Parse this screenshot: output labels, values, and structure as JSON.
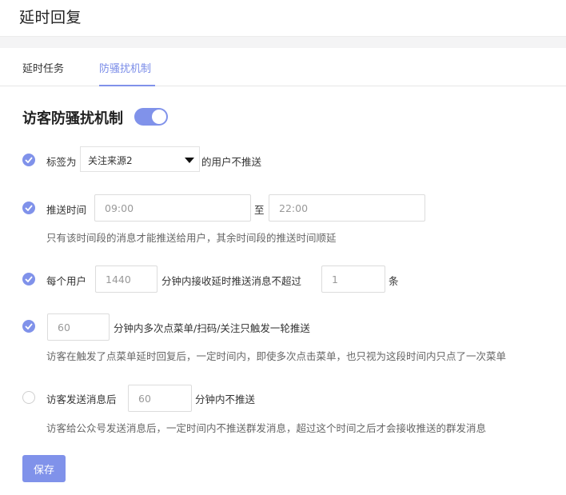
{
  "page": {
    "title": "延时回复"
  },
  "tabs": [
    {
      "label": "延时任务",
      "active": false
    },
    {
      "label": "防骚扰机制",
      "active": true
    }
  ],
  "section": {
    "title": "访客防骚扰机制",
    "enabled": true
  },
  "rules": {
    "tag": {
      "checked": true,
      "prefix": "标签为",
      "selected": "关注来源2",
      "suffix": "的用户不推送"
    },
    "push_time": {
      "checked": true,
      "label": "推送时间",
      "start_placeholder": "09:00",
      "separator": "至",
      "end_placeholder": "22:00",
      "hint": "只有该时间段的消息才能推送给用户，其余时间段的推送时间顺延"
    },
    "per_user": {
      "checked": true,
      "label": "每个用户",
      "minutes_placeholder": "1440",
      "middle": "分钟内接收延时推送消息不超过",
      "count_placeholder": "1",
      "unit": "条"
    },
    "menu_click": {
      "checked": true,
      "minutes_placeholder": "60",
      "text": "分钟内多次点菜单/扫码/关注只触发一轮推送",
      "hint": "访客在触发了点菜单延时回复后，一定时间内，即使多次点击菜单，也只视为这段时间内只点了一次菜单"
    },
    "visitor_msg": {
      "checked": false,
      "label": "访客发送消息后",
      "minutes_placeholder": "60",
      "text": "分钟内不推送",
      "hint": "访客给公众号发送消息后，一定时间内不推送群发消息，超过这个时间之后才会接收推送的群发消息"
    }
  },
  "actions": {
    "save_label": "保存"
  },
  "colors": {
    "accent": "#8092ea",
    "tab_active": "#7a8ce8",
    "border": "#dcdcdc"
  },
  "icons": {
    "check": "check-icon",
    "dropdown": "caret-down-icon"
  }
}
